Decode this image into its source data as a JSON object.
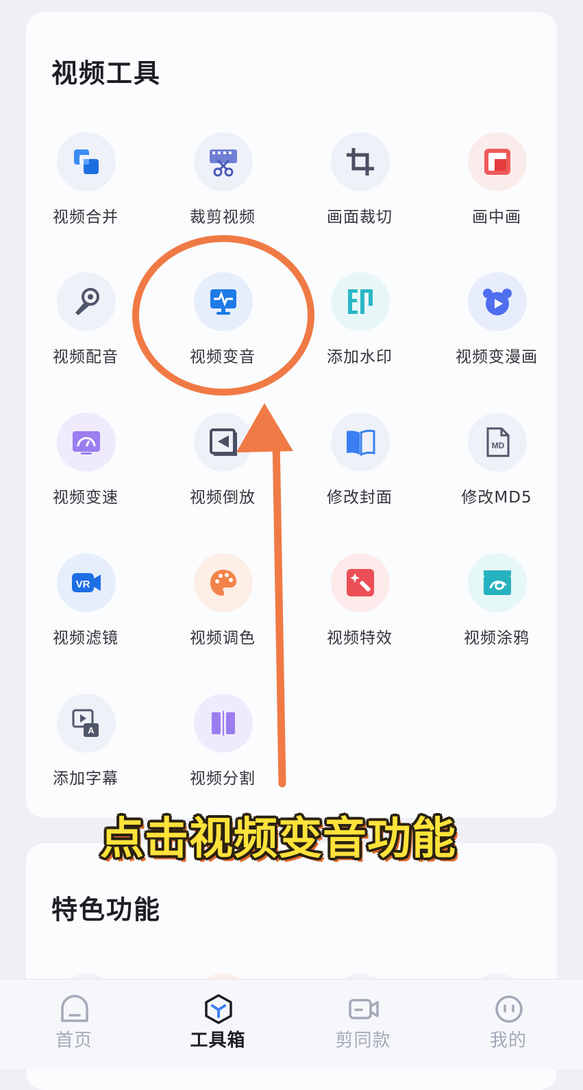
{
  "tools_section": {
    "title": "视频工具",
    "items": [
      {
        "label": "视频合并",
        "icon": "merge-icon"
      },
      {
        "label": "裁剪视频",
        "icon": "scissors-film-icon"
      },
      {
        "label": "画面裁切",
        "icon": "crop-icon"
      },
      {
        "label": "画中画",
        "icon": "picture-in-picture-icon"
      },
      {
        "label": "视频配音",
        "icon": "microphone-icon"
      },
      {
        "label": "视频变音",
        "icon": "voice-wave-monitor-icon"
      },
      {
        "label": "添加水印",
        "icon": "watermark-stamp-icon"
      },
      {
        "label": "视频变漫画",
        "icon": "bear-play-icon"
      },
      {
        "label": "视频变速",
        "icon": "speedometer-icon"
      },
      {
        "label": "视频倒放",
        "icon": "rewind-icon"
      },
      {
        "label": "修改封面",
        "icon": "book-cover-icon"
      },
      {
        "label": "修改MD5",
        "icon": "md-file-icon"
      },
      {
        "label": "视频滤镜",
        "icon": "vr-camera-icon"
      },
      {
        "label": "视频调色",
        "icon": "palette-icon"
      },
      {
        "label": "视频特效",
        "icon": "magic-wand-icon"
      },
      {
        "label": "视频涂鸦",
        "icon": "doodle-clapper-icon"
      },
      {
        "label": "添加字幕",
        "icon": "subtitle-icon"
      },
      {
        "label": "视频分割",
        "icon": "split-icon"
      }
    ]
  },
  "features_section": {
    "title": "特色功能"
  },
  "bottom_nav": [
    {
      "label": "首页",
      "icon": "home-icon",
      "active": false
    },
    {
      "label": "工具箱",
      "icon": "toolbox-icon",
      "active": true
    },
    {
      "label": "剪同款",
      "icon": "video-camera-icon",
      "active": false
    },
    {
      "label": "我的",
      "icon": "profile-icon",
      "active": false
    }
  ],
  "annotation": {
    "caption": "点击视频变音功能",
    "highlight_color": "#f07a45",
    "caption_color": "#ffe23a"
  }
}
